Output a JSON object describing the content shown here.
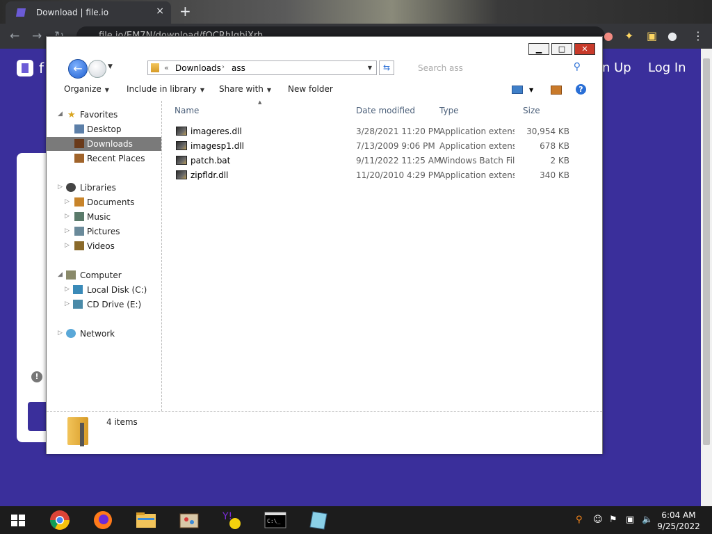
{
  "browser": {
    "tab_title": "Download | file.io",
    "tab_close": "×",
    "new_tab": "+",
    "url": "file.io/EM7N/download/fOCRhJqbiXrh",
    "site_letter": "f",
    "signup_label": "n Up",
    "login_label": "Log In",
    "warn_glyph": "!"
  },
  "explorer": {
    "window_controls": {
      "minimize": "▁",
      "maximize": "□",
      "close": "✕"
    },
    "address": {
      "chevron": "«",
      "crumb1": "Downloads",
      "separator": "›",
      "crumb2": "ass"
    },
    "search": {
      "placeholder": "Search ass"
    },
    "toolbar": {
      "organize": "Organize",
      "include_in_library": "Include in library",
      "share_with": "Share with",
      "new_folder": "New folder"
    },
    "nav": {
      "favorites": {
        "label": "Favorites",
        "items": [
          "Desktop",
          "Downloads",
          "Recent Places"
        ]
      },
      "libraries": {
        "label": "Libraries",
        "items": [
          "Documents",
          "Music",
          "Pictures",
          "Videos"
        ]
      },
      "computer": {
        "label": "Computer",
        "items": [
          "Local Disk (C:)",
          "CD Drive (E:)"
        ]
      },
      "network": {
        "label": "Network"
      }
    },
    "columns": {
      "name": "Name",
      "date": "Date modified",
      "type": "Type",
      "size": "Size"
    },
    "files": [
      {
        "name": "imageres.dll",
        "date": "3/28/2021 11:20 PM",
        "type": "Application extens...",
        "size": "30,954 KB"
      },
      {
        "name": "imagesp1.dll",
        "date": "7/13/2009 9:06 PM",
        "type": "Application extens...",
        "size": "678 KB"
      },
      {
        "name": "patch.bat",
        "date": "9/11/2022 11:25 AM",
        "type": "Windows Batch File",
        "size": "2 KB"
      },
      {
        "name": "zipfldr.dll",
        "date": "11/20/2010 4:29 PM",
        "type": "Application extens...",
        "size": "340 KB"
      }
    ],
    "status": {
      "count": "4 items"
    }
  },
  "taskbar": {
    "time": "6:04 AM",
    "date": "9/25/2022"
  },
  "colors": {
    "site_purple": "#3a2f9b",
    "selection": "#7a7a7a",
    "close_red": "#c83a2a"
  }
}
